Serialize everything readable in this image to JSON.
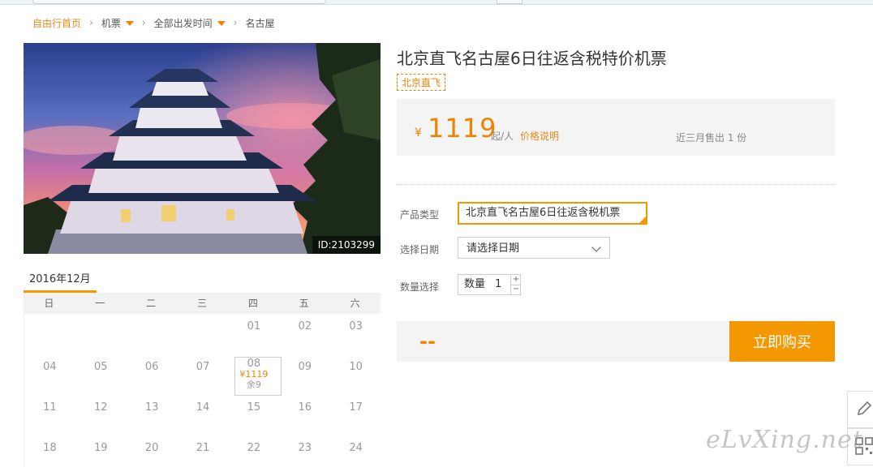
{
  "breadcrumb": {
    "home": "自由行首页",
    "items": [
      "机票",
      "全部出发时间",
      "名古屋"
    ]
  },
  "hero": {
    "photo_id": "ID:2103299"
  },
  "product": {
    "title": "北京直飞名古屋6日往返含税特价机票",
    "tag": "北京直飞",
    "currency": "¥",
    "price": "1119",
    "price_unit": "起/人",
    "price_note": "价格说明",
    "sold": "近三月售出 1 份"
  },
  "form": {
    "type_label": "产品类型",
    "type_value": "北京直飞名古屋6日往返含税机票",
    "date_label": "选择日期",
    "date_placeholder": "请选择日期",
    "qty_label": "数量选择",
    "qty_field_label": "数量",
    "qty_value": "1",
    "plus": "+",
    "minus": "−"
  },
  "purchase": {
    "total": "--",
    "buy_label": "立即购买"
  },
  "calendar": {
    "month": "2016年12月",
    "weekdays": [
      "日",
      "一",
      "二",
      "三",
      "四",
      "五",
      "六"
    ],
    "rows": [
      [
        "",
        "",
        "",
        "",
        "01",
        "02",
        "03"
      ],
      [
        "04",
        "05",
        "06",
        "07",
        "08",
        "09",
        "10"
      ],
      [
        "11",
        "12",
        "13",
        "14",
        "15",
        "16",
        "17"
      ],
      [
        "18",
        "19",
        "20",
        "21",
        "22",
        "23",
        "24"
      ]
    ],
    "selected": {
      "price": "¥1119",
      "remaining": "余9"
    }
  },
  "watermark": "eLvXing.net",
  "colors": {
    "accent": "#f39800",
    "price": "#f08300"
  }
}
